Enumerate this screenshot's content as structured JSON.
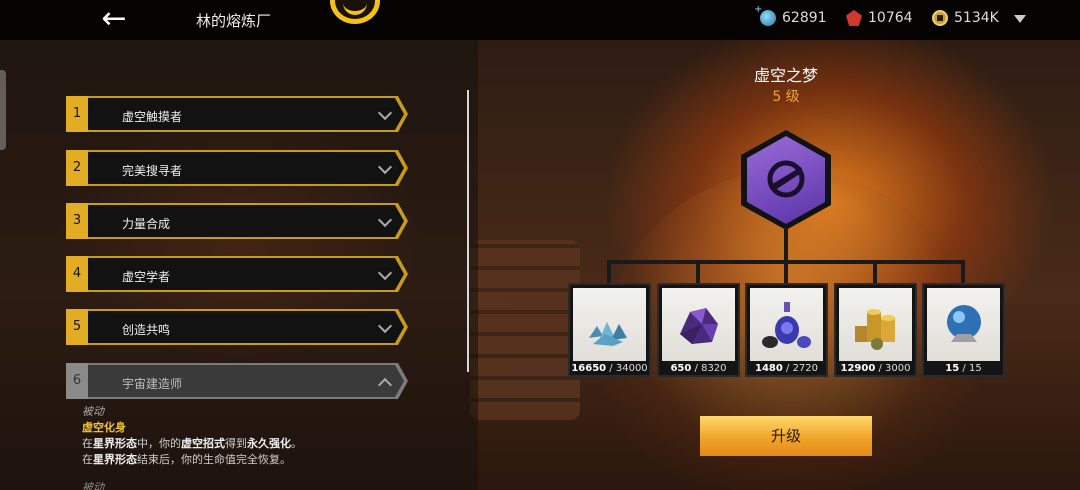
{
  "header": {
    "back_icon": "arrow-left-icon",
    "title": "林的熔炼厂",
    "currencies": [
      {
        "icon": "swirl-gem-icon",
        "value": "62891"
      },
      {
        "icon": "red-crystal-icon",
        "value": "10764"
      },
      {
        "icon": "gold-coin-icon",
        "value": "5134K"
      }
    ]
  },
  "skills": [
    {
      "num": "1",
      "label": "虚空触摸者",
      "state": "collapsed"
    },
    {
      "num": "2",
      "label": "完美搜寻者",
      "state": "collapsed"
    },
    {
      "num": "3",
      "label": "力量合成",
      "state": "collapsed"
    },
    {
      "num": "4",
      "label": "虚空学者",
      "state": "collapsed"
    },
    {
      "num": "5",
      "label": "创造共鸣",
      "state": "collapsed"
    },
    {
      "num": "6",
      "label": "宇宙建造师",
      "state": "expanded-locked"
    }
  ],
  "description": {
    "type": "被动",
    "name": "虚空化身",
    "line1_a": "在",
    "line1_b": "星界形态",
    "line1_c": "中，你的",
    "line1_d": "虚空招式",
    "line1_e": "得到",
    "line1_f": "永久强化",
    "line1_g": "。",
    "line2_a": "在",
    "line2_b": "星界形态",
    "line2_c": "结束后，你的生命值完全恢复。",
    "type2": "被动"
  },
  "detail": {
    "title": "虚空之梦",
    "level": "5 级",
    "badge_icon": "void-dagger-icon"
  },
  "materials": [
    {
      "icon": "blue-crystal-shards-icon",
      "current": "16650",
      "required": "34000"
    },
    {
      "icon": "purple-ore-icon",
      "current": "650",
      "required": "8320"
    },
    {
      "icon": "potion-bottles-icon",
      "current": "1480",
      "required": "2720"
    },
    {
      "icon": "gold-coin-stacks-icon",
      "current": "12900",
      "required": "3000"
    },
    {
      "icon": "blue-orb-icon",
      "current": "15",
      "required": "15"
    }
  ],
  "upgrade_label": "升级",
  "colors": {
    "accent_gold": "#e2ad22",
    "level_orange": "#e8a838",
    "badge_purple": "#7a4fc2"
  }
}
